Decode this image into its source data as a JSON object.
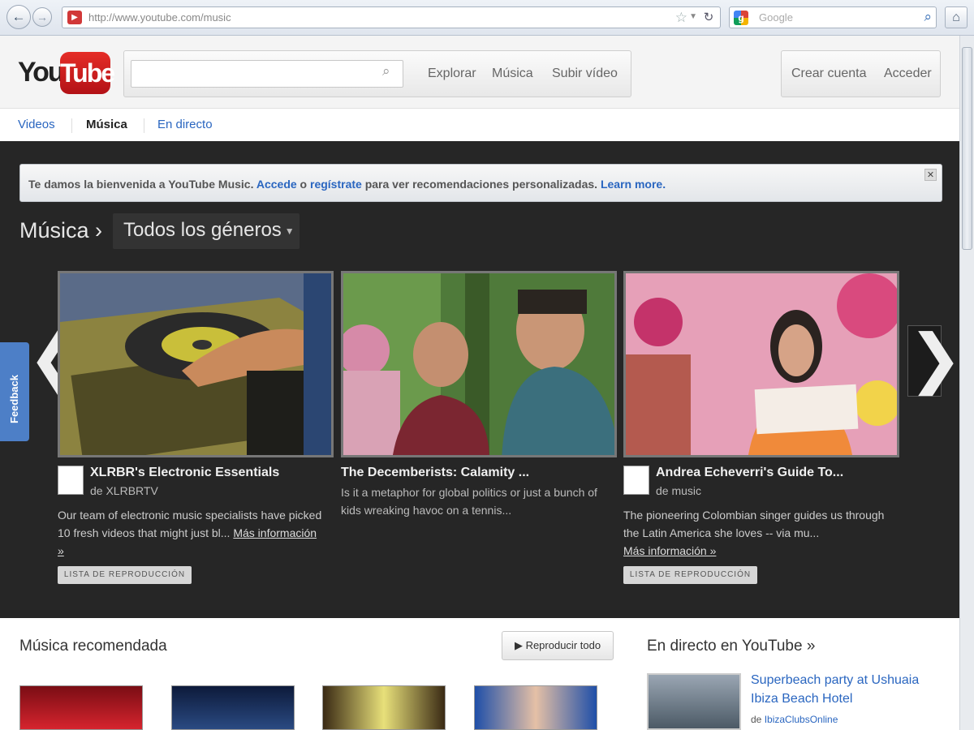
{
  "browser": {
    "url": "http://www.youtube.com/music",
    "search_placeholder": "Google"
  },
  "header": {
    "logo_you": "You",
    "logo_tube": "Tube",
    "search_value": "",
    "links": [
      "Explorar",
      "Música",
      "Subir vídeo"
    ],
    "create_account": "Crear cuenta",
    "sign_in": "Acceder"
  },
  "subnav": {
    "items": [
      "Videos",
      "Música",
      "En directo"
    ],
    "active": "Música"
  },
  "notice": {
    "pre": "Te damos la bienvenida a YouTube Music. ",
    "link1": "Accede",
    "mid1": " o ",
    "link2": "regístrate",
    "mid2": " para ver recomendaciones personalizadas. ",
    "link3": "Learn more.",
    "close": "✕"
  },
  "stage": {
    "section_title": "Música ›",
    "genre_dropdown": "Todos los géneros",
    "arrow_left": "❮",
    "arrow_right": "❯",
    "feedback": "Feedback"
  },
  "cards": [
    {
      "title": "XLRBR's Electronic Essentials",
      "author": "de XLRBRTV",
      "desc": "Our team of electronic music specialists have picked 10 fresh videos that might just bl... ",
      "more": "Más información »",
      "badge": "LISTA DE REPRODUCCIÓN"
    },
    {
      "title": "The Decemberists: Calamity ...",
      "desc": "Is it a metaphor for global politics or just a bunch of kids wreaking havoc on a tennis..."
    },
    {
      "title": "Andrea Echeverri's Guide To...",
      "author": "de music",
      "desc": "The pioneering Colombian singer guides us through the Latin America she loves -- via mu...",
      "more": "Más información »",
      "badge": "LISTA DE REPRODUCCIÓN"
    }
  ],
  "bottom": {
    "reco_title": "Música recomendada",
    "play_all": "Reproducir todo",
    "live_title": "En directo en YouTube »",
    "live_link": "Superbeach party at Ushuaia Ibiza Beach Hotel",
    "live_author_prefix": "de ",
    "live_author": "IbizaClubsOnline"
  },
  "colors": {
    "stage_bg": "#262626",
    "link_blue": "#2a66c0",
    "youtube_red": "#e52d27",
    "feedback_blue": "#4d7fc7"
  }
}
